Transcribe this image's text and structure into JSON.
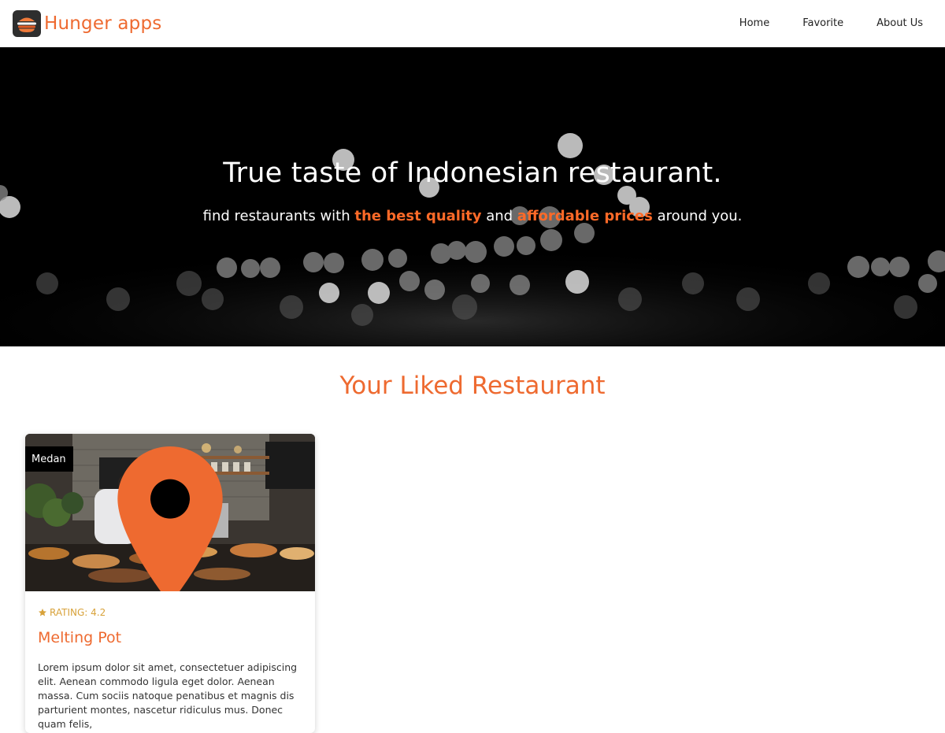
{
  "header": {
    "brand_name": "Hunger apps",
    "logo_icon": "burger-logo-icon",
    "nav": [
      {
        "label": "Home"
      },
      {
        "label": "Favorite"
      },
      {
        "label": "About Us"
      }
    ]
  },
  "hero": {
    "title": "True taste of Indonesian restaurant.",
    "tagline": {
      "part1": "find restaurants with ",
      "highlight1": "the best quality",
      "part2": " and ",
      "highlight2": "affordable prices",
      "part3": " around you."
    },
    "background": "bokeh-lights-image"
  },
  "section": {
    "title": "Your Liked Restaurant"
  },
  "restaurants": [
    {
      "city": "Medan",
      "rating_label": "RATING: 4.2",
      "name": "Melting Pot",
      "description": "Lorem ipsum dolor sit amet, consectetuer adipiscing elit. Aenean commodo ligula eget dolor. Aenean massa. Cum sociis natoque penatibus et magnis dis parturient montes, nascetur ridiculus mus. Donec quam felis,"
    }
  ],
  "colors": {
    "accent": "#ee6a30",
    "hero_highlight": "#ff6a28",
    "rating": "#d8a23a",
    "badge_bg": "#000000"
  }
}
